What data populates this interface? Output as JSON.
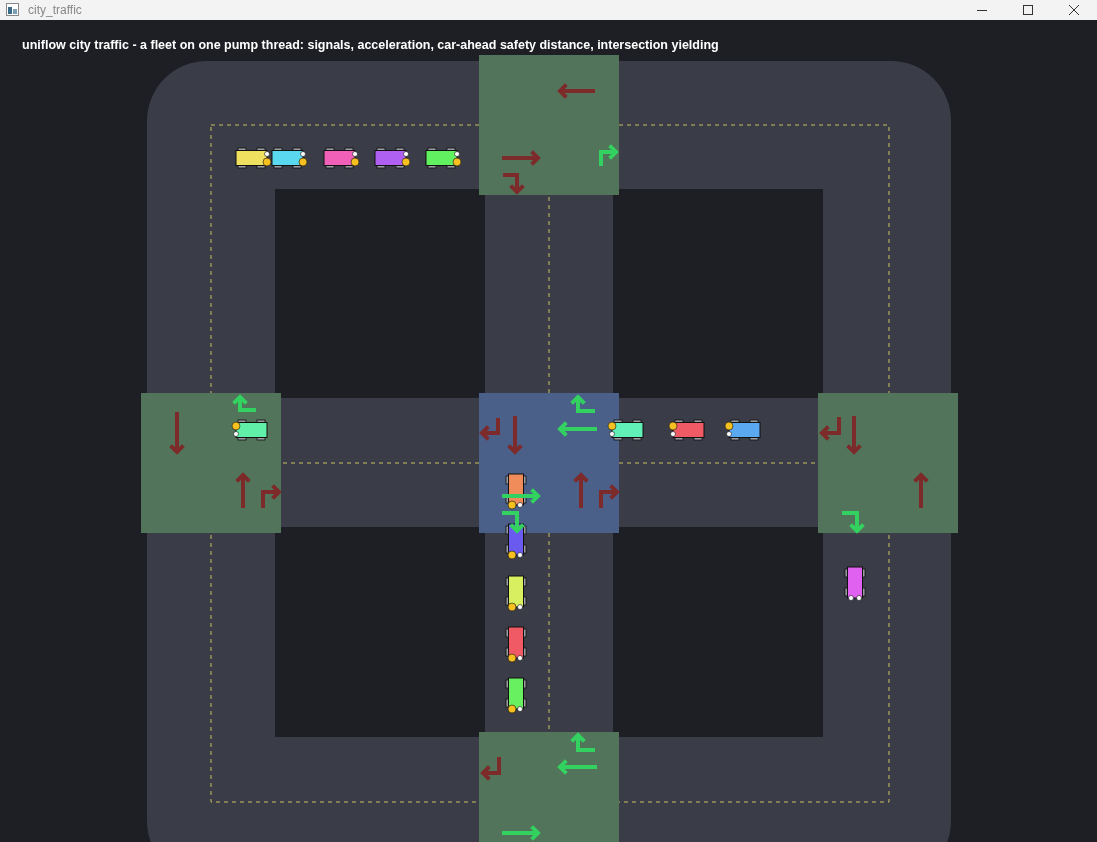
{
  "window": {
    "title": "city_traffic"
  },
  "heading": "uniflow city traffic - a fleet on one pump thread: signals, acceleration, car-ahead safety distance, intersection yielding",
  "intersections": [
    {
      "highlighted": false,
      "signals": [
        {
          "go": false
        },
        {
          "go": false
        },
        {
          "go": false
        },
        {
          "go": true
        }
      ]
    },
    {
      "highlighted": false,
      "signals": [
        {
          "go": false
        },
        {
          "go": true
        },
        {
          "go": false
        },
        {
          "go": false
        }
      ]
    },
    {
      "highlighted": true,
      "signals": [
        {
          "go": false
        },
        {
          "go": false
        },
        {
          "go": true
        },
        {
          "go": true
        },
        {
          "go": true
        },
        {
          "go": true
        },
        {
          "go": false
        },
        {
          "go": false
        }
      ]
    },
    {
      "highlighted": false,
      "signals": [
        {
          "go": false
        },
        {
          "go": false
        },
        {
          "go": false
        },
        {
          "go": true
        }
      ]
    },
    {
      "highlighted": false,
      "signals": [
        {
          "go": false
        },
        {
          "go": true
        },
        {
          "go": true
        },
        {
          "go": true
        }
      ]
    }
  ],
  "cars": [
    {
      "color": "#f0e060",
      "indicator": true
    },
    {
      "color": "#5ad8f0",
      "indicator": true
    },
    {
      "color": "#f060b8",
      "indicator": true
    },
    {
      "color": "#b060f0",
      "indicator": true
    },
    {
      "color": "#60f060",
      "indicator": true
    },
    {
      "color": "#60f0a8",
      "indicator": true
    },
    {
      "color": "#60f0b8",
      "indicator": true
    },
    {
      "color": "#f05a64",
      "indicator": true
    },
    {
      "color": "#5aa8f0",
      "indicator": true
    },
    {
      "color": "#f08c5a",
      "indicator": true
    },
    {
      "color": "#6a5af0",
      "indicator": true
    },
    {
      "color": "#d8f060",
      "indicator": true
    },
    {
      "color": "#f05a64",
      "indicator": true
    },
    {
      "color": "#68f060",
      "indicator": true
    },
    {
      "color": "#e060f0",
      "indicator": false
    }
  ]
}
